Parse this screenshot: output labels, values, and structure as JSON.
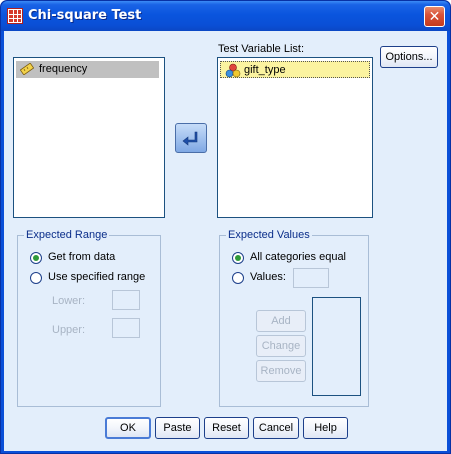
{
  "window": {
    "title": "Chi-square Test",
    "close_glyph": "✕"
  },
  "source_list": {
    "items": [
      {
        "label": "frequency",
        "icon": "scale-ruler-icon",
        "selected": true
      }
    ]
  },
  "test_variable_list": {
    "label": "Test Variable List:",
    "items": [
      {
        "label": "gift_type",
        "icon": "nominal-variable-icon",
        "selected": true
      }
    ]
  },
  "options_button": "Options...",
  "move_arrow": "move-variable-arrow-icon",
  "expected_range": {
    "title": "Expected Range",
    "get_from_data": "Get from data",
    "use_specified": "Use specified range",
    "lower_label": "Lower:",
    "upper_label": "Upper:",
    "lower_value": "",
    "upper_value": "",
    "selected": "get_from_data"
  },
  "expected_values": {
    "title": "Expected Values",
    "all_equal": "All categories equal",
    "values_label": "Values:",
    "values_value": "",
    "add": "Add",
    "change": "Change",
    "remove": "Remove",
    "selected": "all_equal"
  },
  "buttons": {
    "ok": "OK",
    "paste": "Paste",
    "reset": "Reset",
    "cancel": "Cancel",
    "help": "Help"
  },
  "colors": {
    "titlebar": "#0a4fd8",
    "client": "#e3eefb",
    "group_title": "#0b2e8a",
    "radio_dot": "#2f9a3a",
    "selection_yellow": "#fbf3a0",
    "close_button": "#d9533a"
  }
}
